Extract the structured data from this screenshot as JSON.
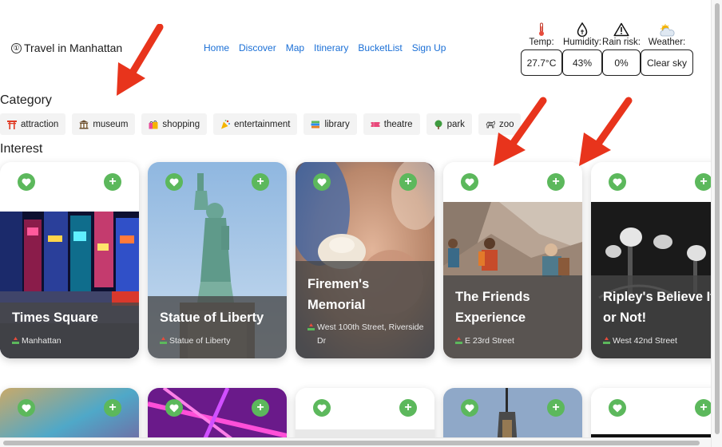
{
  "header": {
    "brand_icon": "①",
    "title": "Travel in Manhattan",
    "nav": [
      "Home",
      "Discover",
      "Map",
      "Itinerary",
      "BucketList",
      "Sign Up"
    ]
  },
  "weather": {
    "temp_label": "Temp:",
    "temp_value": "27.7°C",
    "humidity_label": "Humidity:",
    "humidity_value": "43%",
    "rain_label": "Rain risk:",
    "rain_value": "0%",
    "weather_label": "Weather:",
    "weather_value": "Clear sky"
  },
  "category": {
    "title": "Category",
    "items": [
      {
        "label": "attraction",
        "icon": "torii-gate-icon"
      },
      {
        "label": "museum",
        "icon": "museum-icon"
      },
      {
        "label": "shopping",
        "icon": "shopping-bags-icon"
      },
      {
        "label": "entertainment",
        "icon": "party-icon"
      },
      {
        "label": "library",
        "icon": "books-icon"
      },
      {
        "label": "theatre",
        "icon": "ticket-icon"
      },
      {
        "label": "park",
        "icon": "tree-icon"
      },
      {
        "label": "zoo",
        "icon": "zebra-icon"
      }
    ]
  },
  "interest": {
    "title": "Interest",
    "cards": [
      {
        "title": "Times Square",
        "location": "Manhattan"
      },
      {
        "title": "Statue of Liberty",
        "location": "Statue of Liberty"
      },
      {
        "title": "Firemen's Memorial",
        "location": "West 100th Street, Riverside Dr"
      },
      {
        "title": "The Friends Experience",
        "location": "E 23rd Street"
      },
      {
        "title": "Ripley's Believe It or Not!",
        "location": "West 42nd Street"
      }
    ]
  },
  "icons": {
    "like": "heart-icon",
    "add": "+",
    "location": "pin-icon"
  },
  "colors": {
    "accent_green": "#5cb85c",
    "nav_link": "#1a6fd6",
    "arrow_red": "#e8341c"
  }
}
